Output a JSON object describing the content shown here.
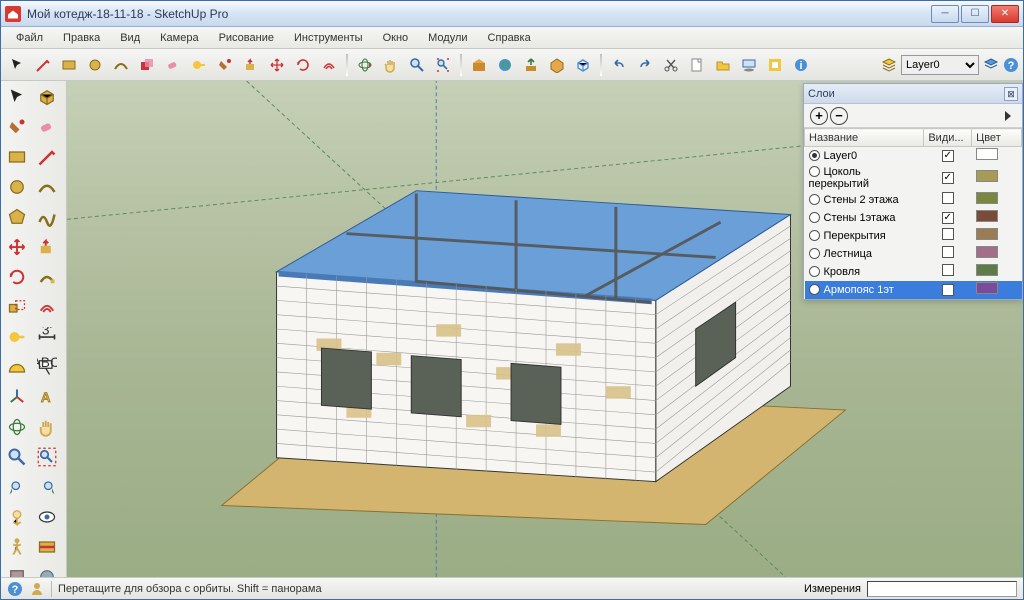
{
  "window": {
    "title": "Мой котедж-18-11-18 - SketchUp Pro"
  },
  "menu": {
    "items": [
      "Файл",
      "Правка",
      "Вид",
      "Камера",
      "Рисование",
      "Инструменты",
      "Окно",
      "Модули",
      "Справка"
    ]
  },
  "toolbar_main": {
    "current_layer": "Layer0"
  },
  "layers": {
    "title": "Слои",
    "col_name": "Название",
    "col_visible": "Види...",
    "col_color": "Цвет",
    "rows": [
      {
        "name": "Layer0",
        "active": true,
        "visible": true,
        "color": "#ffffff"
      },
      {
        "name": "Цоколь перекрытий",
        "active": false,
        "visible": true,
        "color": "#a89b58"
      },
      {
        "name": "Стены 2 этажа",
        "active": false,
        "visible": false,
        "color": "#7a873f"
      },
      {
        "name": "Стены 1этажа",
        "active": false,
        "visible": true,
        "color": "#7b4b3a"
      },
      {
        "name": "Перекрытия",
        "active": false,
        "visible": false,
        "color": "#9a7d54"
      },
      {
        "name": "Лестница",
        "active": false,
        "visible": false,
        "color": "#a26e8a"
      },
      {
        "name": "Кровля",
        "active": false,
        "visible": false,
        "color": "#5f7b47"
      },
      {
        "name": "Армопояс 1эт",
        "active": false,
        "visible": true,
        "color": "#7a4a9c",
        "selected": true
      }
    ]
  },
  "status": {
    "hint": "Перетащите для обзора с орбиты. Shift = панорама",
    "measure_label": "Измерения"
  },
  "tool_palette": [
    "select",
    "make-component",
    "material",
    "eraser",
    "rectangle",
    "line",
    "circle",
    "arc",
    "polygon",
    "freehand",
    "move",
    "push-pull",
    "rotate",
    "follow-me",
    "scale",
    "offset",
    "tape",
    "dimension",
    "protractor",
    "text",
    "axes",
    "3d-text",
    "orbit",
    "pan",
    "zoom",
    "zoom-extents",
    "prev-view",
    "next-view",
    "position-camera",
    "look-around",
    "walk",
    "section",
    "get-models",
    "share",
    "extension",
    "help"
  ],
  "main_toolbar": [
    "select",
    "line",
    "rectangle",
    "circle",
    "arc",
    "make-component",
    "eraser",
    "tape",
    "material",
    "push-pull",
    "move",
    "rotate",
    "offset",
    "orbit",
    "pan",
    "zoom",
    "zoom-extents",
    "get-models",
    "earth",
    "upload",
    "3d-warehouse",
    "iso",
    "undo",
    "redo",
    "save",
    "new",
    "open",
    "shadow",
    "overlay",
    "info"
  ]
}
